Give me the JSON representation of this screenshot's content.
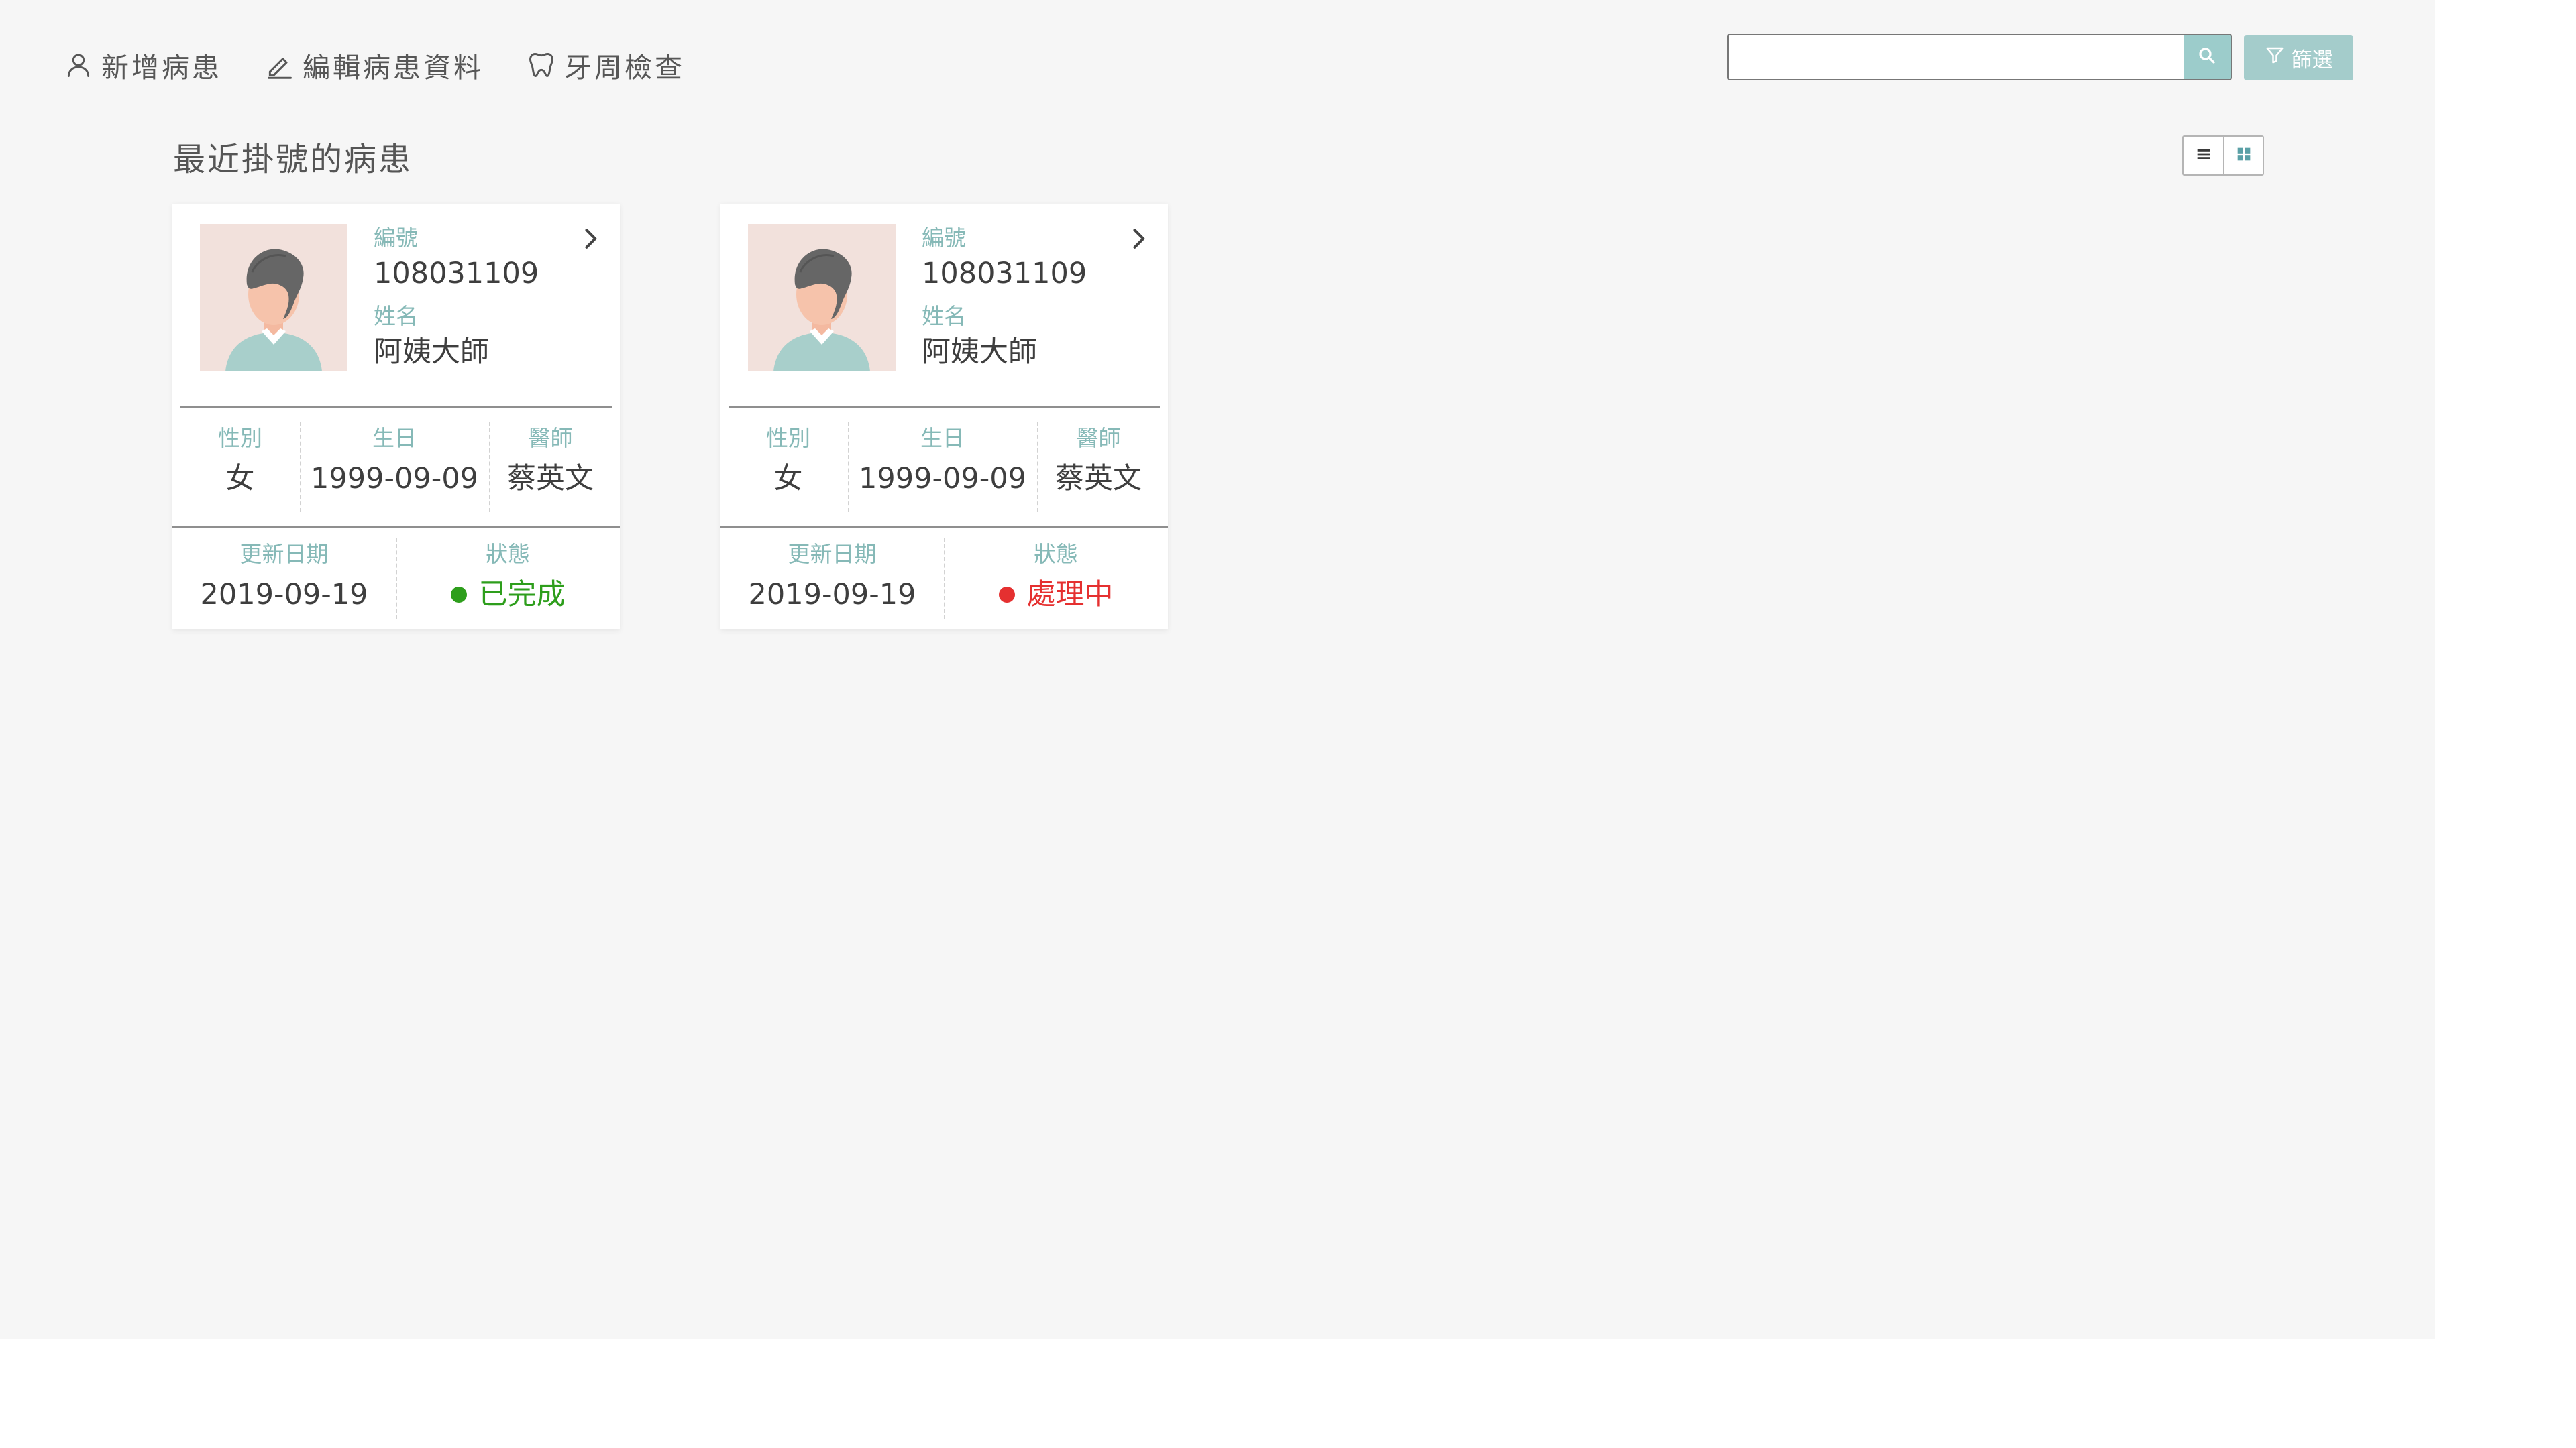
{
  "nav": {
    "add_patient": "新增病患",
    "edit_patient": "編輯病患資料",
    "perio_exam": "牙周檢查",
    "add_patient_icon": "user-icon",
    "edit_patient_icon": "pencil-icon",
    "perio_exam_icon": "tooth-icon"
  },
  "search": {
    "value": "",
    "placeholder": "",
    "button_icon": "search-icon"
  },
  "filter": {
    "label": "篩選",
    "icon": "filter-icon"
  },
  "section": {
    "title": "最近掛號的病患"
  },
  "view_toggle": {
    "list_icon": "list-view-icon",
    "grid_icon": "grid-view-icon",
    "active": "grid"
  },
  "labels": {
    "id": "編號",
    "name": "姓名",
    "gender": "性別",
    "birthday": "生日",
    "doctor": "醫師",
    "updated": "更新日期",
    "status": "狀態"
  },
  "patients": [
    {
      "id": "108031109",
      "name": "阿姨大師",
      "gender": "女",
      "birthday": "1999-09-09",
      "doctor": "蔡英文",
      "updated": "2019-09-19",
      "status": "已完成",
      "status_color": "#2e9e1c"
    },
    {
      "id": "108031109",
      "name": "阿姨大師",
      "gender": "女",
      "birthday": "1999-09-09",
      "doctor": "蔡英文",
      "updated": "2019-09-19",
      "status": "處理中",
      "status_color": "#e53030"
    }
  ],
  "colors": {
    "accent": "#9ccccb",
    "label": "#86b9b7",
    "background": "#f6f6f6"
  }
}
